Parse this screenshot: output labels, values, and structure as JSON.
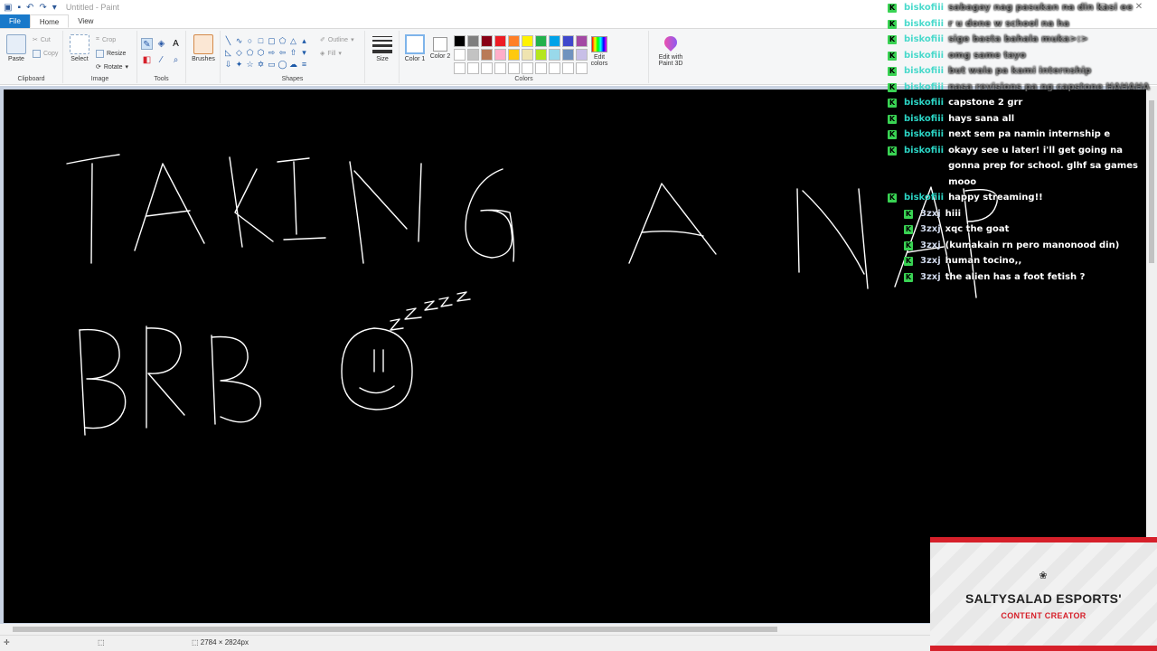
{
  "window": {
    "title": "Untitled - Paint"
  },
  "ribbon_tabs": [
    "File",
    "Home",
    "View"
  ],
  "clipboard": {
    "paste": "Paste",
    "cut": "Cut",
    "copy": "Copy",
    "label": "Clipboard"
  },
  "image": {
    "select": "Select",
    "crop": "Crop",
    "resize": "Resize",
    "rotate": "Rotate",
    "label": "Image"
  },
  "tools": {
    "label": "Tools"
  },
  "brushes": {
    "label": "Brushes"
  },
  "shapes": {
    "label": "Shapes",
    "outline": "Outline",
    "fill": "Fill"
  },
  "size": {
    "label": "Size"
  },
  "colors": {
    "color1": "Color 1",
    "color2": "Color 2",
    "edit_colors": "Edit colors",
    "label": "Colors",
    "palette": [
      "#000000",
      "#7f7f7f",
      "#880015",
      "#ed1c24",
      "#ff7f27",
      "#fff200",
      "#22b14c",
      "#00a2e8",
      "#3f48cc",
      "#a349a4",
      "#ffffff",
      "#c3c3c3",
      "#b97a57",
      "#ffaec9",
      "#ffc90e",
      "#efe4b0",
      "#b5e61d",
      "#99d9ea",
      "#7092be",
      "#c8bfe7",
      "#ffffff",
      "#ffffff",
      "#ffffff",
      "#ffffff",
      "#ffffff",
      "#ffffff",
      "#ffffff",
      "#ffffff",
      "#ffffff",
      "#ffffff"
    ]
  },
  "paint3d": {
    "label": "Edit with Paint 3D"
  },
  "status": {
    "canvas_size": "2784 × 2824px"
  },
  "chat": [
    {
      "user": "biskofiii",
      "text": "sabagay nag pasukan na din kasi ee",
      "faded": true
    },
    {
      "user": "biskofiii",
      "text": "r u done w school na ha",
      "faded": true
    },
    {
      "user": "biskofiii",
      "text": "sige basta bahala muka>:>",
      "faded": true
    },
    {
      "user": "biskofiii",
      "text": "omg same tayo",
      "faded": true
    },
    {
      "user": "biskofiii",
      "text": "but wala pa kami internship",
      "faded": true
    },
    {
      "user": "biskofiii",
      "text": "nasa revisions pa ng capstone HAHAHA",
      "faded": true
    },
    {
      "user": "biskofiii",
      "text": "capstone 2 grr",
      "faded": false
    },
    {
      "user": "biskofiii",
      "text": "hays sana all",
      "faded": false
    },
    {
      "user": "biskofiii",
      "text": "next sem pa namin internship e",
      "faded": false
    },
    {
      "user": "biskofiii",
      "text": "okayy see u later! i'll get going na gonna prep for school. glhf sa games mooo",
      "faded": false
    },
    {
      "user": "biskofiii",
      "text": "happy streaming!!",
      "faded": false
    },
    {
      "user": "3zxj",
      "text": "hiii",
      "faded": false
    },
    {
      "user": "3zxj",
      "text": "xqc the goat",
      "faded": false
    },
    {
      "user": "3zxj",
      "text": "(kumakain rn pero manonood din)",
      "faded": false
    },
    {
      "user": "3zxj",
      "text": "human tocino,,",
      "faded": false
    },
    {
      "user": "3zxj",
      "text": "the alien has a foot fetish ?",
      "faded": false
    }
  ],
  "brand": {
    "name": "SALTYSALAD ESPORTS'",
    "role": "CONTENT CREATOR"
  }
}
